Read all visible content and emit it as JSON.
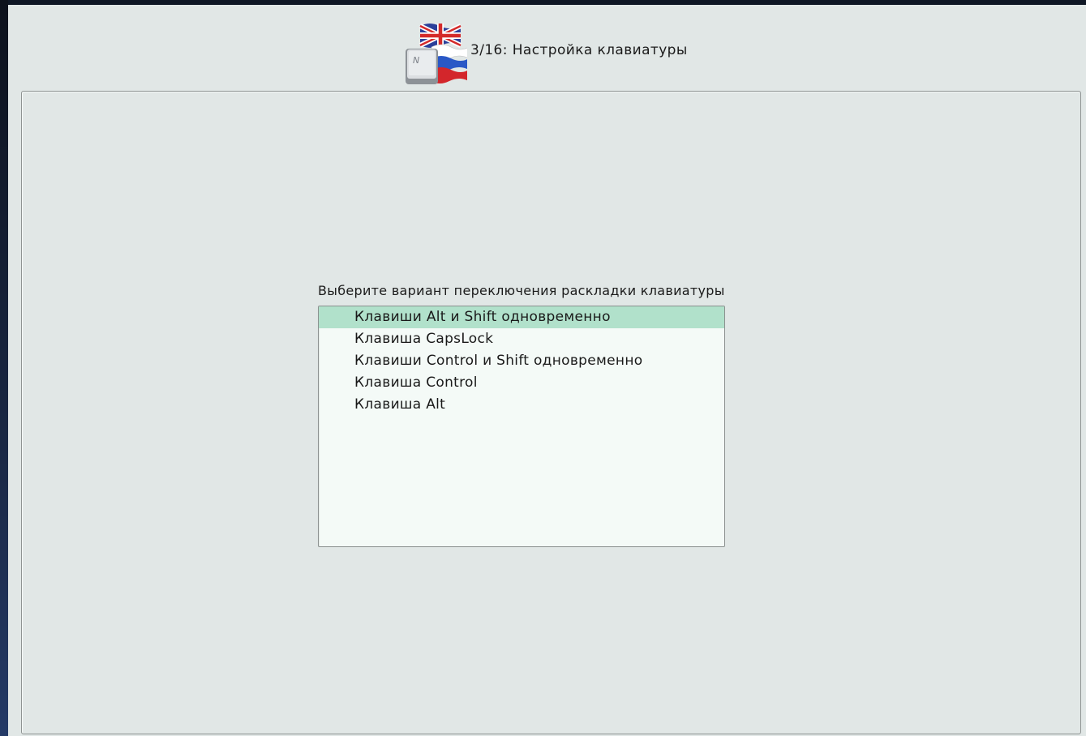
{
  "header": {
    "title": "3/16: Настройка клавиатуры",
    "icon": "keyboard-language-flags-icon"
  },
  "main": {
    "prompt": "Выберите вариант переключения раскладки клавиатуры",
    "options": [
      {
        "label": "Клавиши Alt и Shift одновременно",
        "selected": true
      },
      {
        "label": "Клавиша CapsLock",
        "selected": false
      },
      {
        "label": "Клавиши Control и Shift одновременно",
        "selected": false
      },
      {
        "label": "Клавиша Control",
        "selected": false
      },
      {
        "label": "Клавиша Alt",
        "selected": false
      }
    ]
  },
  "colors": {
    "window_bg": "#e1e7e6",
    "list_bg": "#f4faf7",
    "selection": "#b1e1cb",
    "desktop": "#0f1725"
  }
}
